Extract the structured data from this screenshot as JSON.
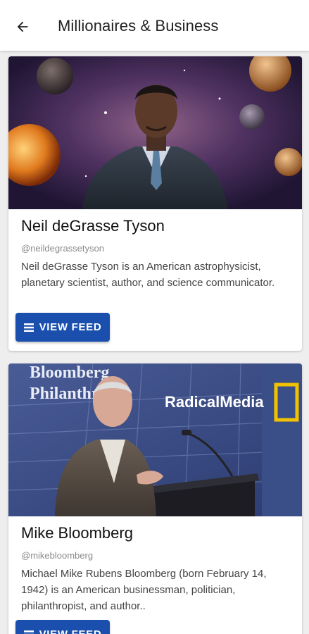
{
  "appbar": {
    "back_icon": "arrow-left-icon",
    "title": "Millionaires & Business"
  },
  "profiles": [
    {
      "name": "Neil deGrasse Tyson",
      "handle": "@neildegrassetyson",
      "description": "Neil deGrasse Tyson is an American astrophysicist, planetary scientist, author, and science communicator.",
      "button_icon": "menu-icon",
      "button_label": "VIEW FEED"
    },
    {
      "name": "Mike Bloomberg",
      "handle": "@mikebloomberg",
      "description": "Michael Mike Rubens Bloomberg (born February 14, 1942) is an American businessman, politician, philanthropist, and author..",
      "button_icon": "menu-icon",
      "button_label": "VIEW FEED",
      "photo_text": {
        "banner_line1": "Bloomberg",
        "banner_line2": "Philanthro",
        "sponsor": "RadicalMedia"
      }
    }
  ],
  "colors": {
    "button": "#1a4fae",
    "appbar": "#ffffff",
    "background": "#eeeeee"
  }
}
